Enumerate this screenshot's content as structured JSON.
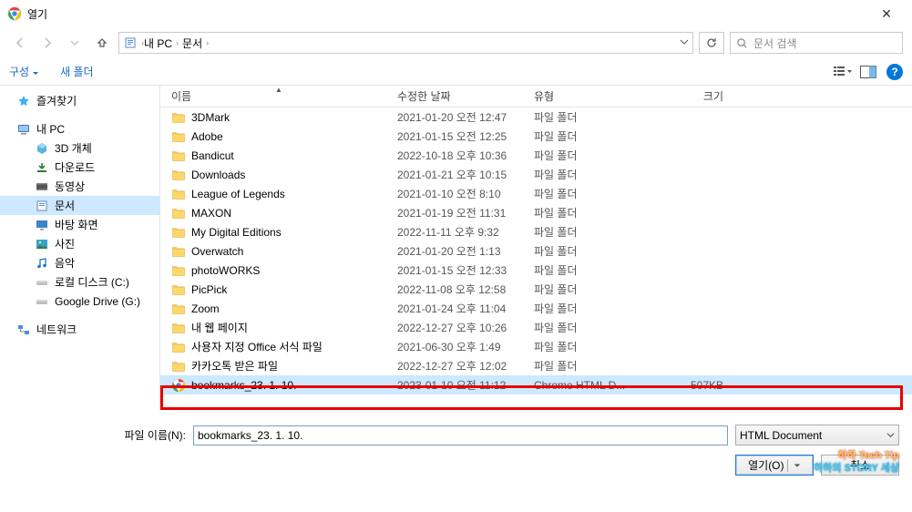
{
  "window": {
    "title": "열기"
  },
  "nav": {
    "crumb1": "내 PC",
    "crumb2": "문서"
  },
  "search": {
    "placeholder": "문서 검색"
  },
  "toolbar": {
    "organize": "구성",
    "newfolder": "새 폴더"
  },
  "columns": {
    "name": "이름",
    "date": "수정한 날짜",
    "type": "유형",
    "size": "크기"
  },
  "tree": {
    "quick": "즐겨찾기",
    "pc": "내 PC",
    "pc_children": {
      "obj3d": "3D 개체",
      "downloads": "다운로드",
      "videos": "동영상",
      "documents": "문서",
      "desktop": "바탕 화면",
      "pictures": "사진",
      "music": "음악",
      "localdisk": "로컬 디스크 (C:)",
      "gdrive": "Google Drive (G:)"
    },
    "network": "네트워크"
  },
  "files": [
    {
      "name": "3DMark",
      "date": "2021-01-20 오전 12:47",
      "type": "파일 폴더",
      "size": "",
      "kind": "folder"
    },
    {
      "name": "Adobe",
      "date": "2021-01-15 오전 12:25",
      "type": "파일 폴더",
      "size": "",
      "kind": "folder"
    },
    {
      "name": "Bandicut",
      "date": "2022-10-18 오후 10:36",
      "type": "파일 폴더",
      "size": "",
      "kind": "folder"
    },
    {
      "name": "Downloads",
      "date": "2021-01-21 오후 10:15",
      "type": "파일 폴더",
      "size": "",
      "kind": "folder"
    },
    {
      "name": "League of Legends",
      "date": "2021-01-10 오전 8:10",
      "type": "파일 폴더",
      "size": "",
      "kind": "folder"
    },
    {
      "name": "MAXON",
      "date": "2021-01-19 오전 11:31",
      "type": "파일 폴더",
      "size": "",
      "kind": "folder"
    },
    {
      "name": "My Digital Editions",
      "date": "2022-11-11 오후 9:32",
      "type": "파일 폴더",
      "size": "",
      "kind": "folder"
    },
    {
      "name": "Overwatch",
      "date": "2021-01-20 오전 1:13",
      "type": "파일 폴더",
      "size": "",
      "kind": "folder"
    },
    {
      "name": "photoWORKS",
      "date": "2021-01-15 오전 12:33",
      "type": "파일 폴더",
      "size": "",
      "kind": "folder"
    },
    {
      "name": "PicPick",
      "date": "2022-11-08 오후 12:58",
      "type": "파일 폴더",
      "size": "",
      "kind": "folder"
    },
    {
      "name": "Zoom",
      "date": "2021-01-24 오후 11:04",
      "type": "파일 폴더",
      "size": "",
      "kind": "folder"
    },
    {
      "name": "내 웹 페이지",
      "date": "2022-12-27 오후 10:26",
      "type": "파일 폴더",
      "size": "",
      "kind": "folder"
    },
    {
      "name": "사용자 지정 Office 서식 파일",
      "date": "2021-06-30 오후 1:49",
      "type": "파일 폴더",
      "size": "",
      "kind": "folder"
    },
    {
      "name": "카카오톡 받은 파일",
      "date": "2022-12-27 오후 12:02",
      "type": "파일 폴더",
      "size": "",
      "kind": "folder"
    },
    {
      "name": "bookmarks_23. 1. 10.",
      "date": "2023-01-10 오전 11:12",
      "type": "Chrome HTML D...",
      "size": "507KB",
      "kind": "chrome",
      "selected": true
    }
  ],
  "bottom": {
    "fname_label": "파일 이름(N):",
    "fname_value": "bookmarks_23. 1. 10.",
    "filter": "HTML Document",
    "open": "열기(O)",
    "cancel": "취소"
  },
  "watermark": {
    "line1": "하하 Tech Tip",
    "line2": "하하의 STORY 세상"
  }
}
